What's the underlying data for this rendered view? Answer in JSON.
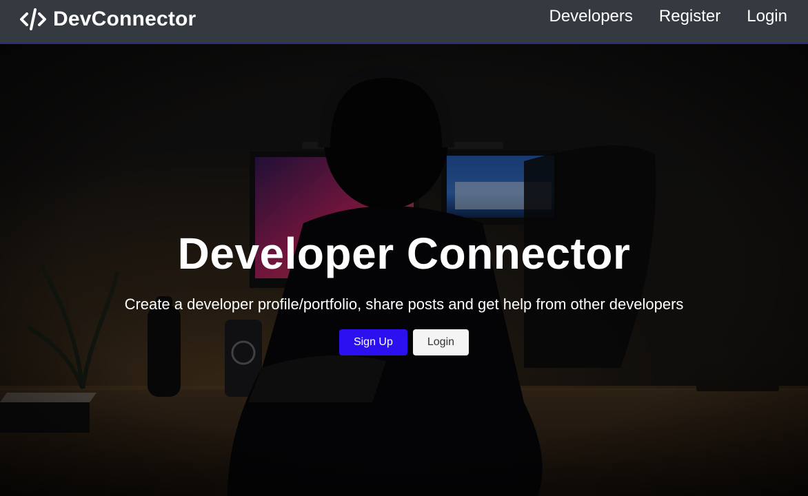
{
  "navbar": {
    "brand": "DevConnector",
    "brand_icon": "code-icon",
    "links": [
      {
        "label": "Developers"
      },
      {
        "label": "Register"
      },
      {
        "label": "Login"
      }
    ]
  },
  "hero": {
    "title": "Developer Connector",
    "subtitle": "Create a developer profile/portfolio, share posts and get help from other developers",
    "buttons": {
      "signup": "Sign Up",
      "login": "Login"
    },
    "background_scene": "person-at-desk-with-monitors"
  },
  "colors": {
    "navbar_bg": "#343a40",
    "primary": "#2c10f0",
    "light": "#f4f4f4"
  }
}
